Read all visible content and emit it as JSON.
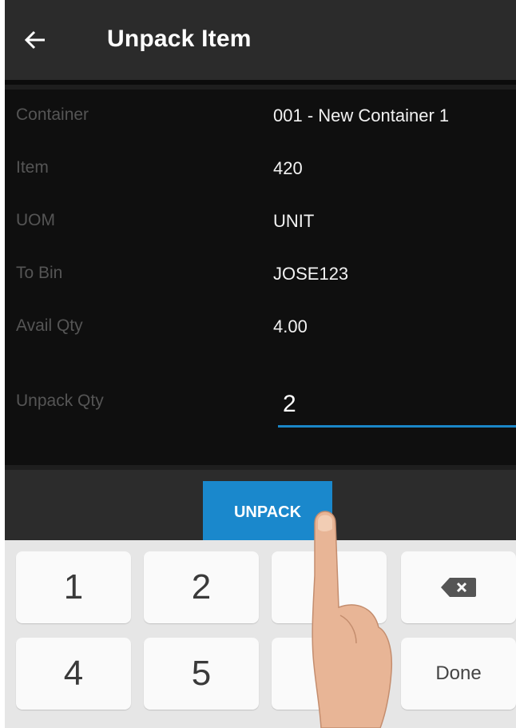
{
  "appbar": {
    "back_icon": "arrow-left-icon",
    "title": "Unpack Item"
  },
  "form": {
    "rows": [
      {
        "label": "Container",
        "value": "001 - New Container 1"
      },
      {
        "label": "Item",
        "value": "420"
      },
      {
        "label": "UOM",
        "value": "UNIT"
      },
      {
        "label": "To Bin",
        "value": "JOSE123"
      },
      {
        "label": "Avail Qty",
        "value": "4.00"
      }
    ],
    "unpack_qty": {
      "label": "Unpack Qty",
      "value": "2"
    }
  },
  "actions": {
    "unpack_label": "UNPACK"
  },
  "keypad": {
    "keys": [
      "1",
      "2",
      "",
      "4",
      "5",
      ""
    ],
    "backspace_icon": "backspace-icon",
    "done_label": "Done"
  },
  "colors": {
    "accent": "#1a88cc",
    "background": "#0f0f0f",
    "appbar": "#2b2b2b"
  }
}
